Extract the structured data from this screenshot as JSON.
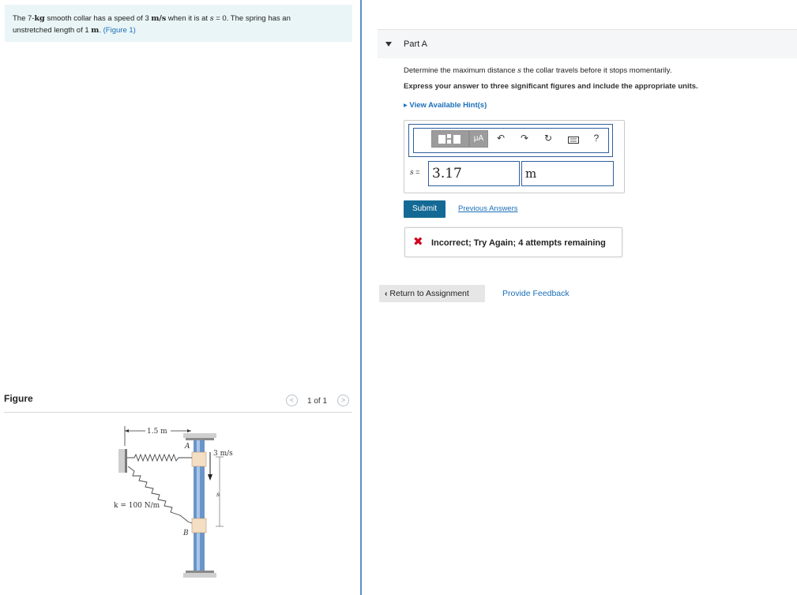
{
  "problem": {
    "p1": "The 7-",
    "kg": "kg",
    "p2": " smooth collar has a speed of 3 ",
    "ms": "m/s",
    "p3": " when it is at ",
    "s": "s",
    "p4": " = 0. The spring has an",
    "p5": "unstretched length of 1 ",
    "m": "m",
    "p6": ". ",
    "figure_link": "(Figure 1)"
  },
  "figure_panel": {
    "label": "Figure",
    "counter": "1 of 1",
    "prev_glyph": "<",
    "next_glyph": ">",
    "labels": {
      "dist": "1.5 m",
      "A": "A",
      "B": "B",
      "speed": "3 m/s",
      "k": "k = 100 N/m",
      "s": "s"
    }
  },
  "part": {
    "title": "Part A",
    "q1a": "Determine the maximum distance ",
    "q1s": "s",
    "q1b": " the collar travels before it stops momentarily.",
    "q2": "Express your answer to three significant figures and include the appropriate units.",
    "hint": "▸ View Available Hint(s)"
  },
  "toolbar": {
    "mu_label": "μA",
    "help_label": "?",
    "icons": [
      "template-icon",
      "mu-units-icon",
      "undo-icon",
      "redo-icon",
      "reset-icon",
      "keyboard-icon",
      "help-icon"
    ]
  },
  "answer": {
    "var_label": "s",
    "eq": " =",
    "value": "3.17",
    "unit": "m"
  },
  "actions": {
    "submit": "Submit",
    "previous": "Previous Answers"
  },
  "feedback": {
    "icon": "✖",
    "text": "Incorrect; Try Again; 4 attempts remaining"
  },
  "nav": {
    "return": "Return to Assignment",
    "provide": "Provide Feedback"
  },
  "colors": {
    "accent": "#1a6fb8",
    "submit_bg": "#146a94",
    "error": "#d0021b",
    "problem_bg": "#eaf5f7"
  }
}
